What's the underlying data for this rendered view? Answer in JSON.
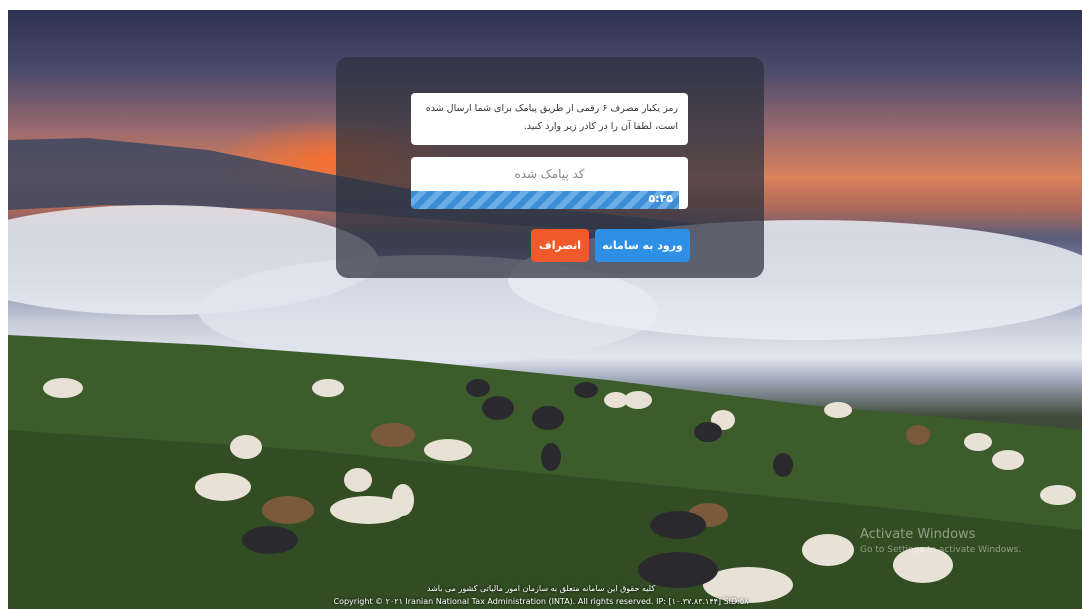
{
  "dialog": {
    "info_text": "رمز یکبار مصرف ۶ رقمی از طریق پیامک برای شما ارسال شده است، لطفا آن را در کادر زیر وارد کنید.",
    "code_placeholder": "کد پیامک شده",
    "timer": "۵:۴۵",
    "progress_fraction": 0.97,
    "login_label": "ورود به سامانه",
    "cancel_label": "انصراف"
  },
  "footer": {
    "rights_fa": "کلیه حقوق این سامانه متعلق به سازمان امور مالیاتی کشور می باشد",
    "copyright_en": "Copyright © ۲۰۲۱ Iranian National Tax Administration (INTA). All rights reserved. IP: [۱۰.۳۷.۸۳.۱۴۴] SID:۵۸"
  },
  "watermark": {
    "line1": "Activate Windows",
    "line2": "Go to Settings to activate Windows."
  },
  "colors": {
    "login_button": "#2e8fe6",
    "cancel_button": "#f05a2a",
    "progress": "#3e8ed6"
  }
}
